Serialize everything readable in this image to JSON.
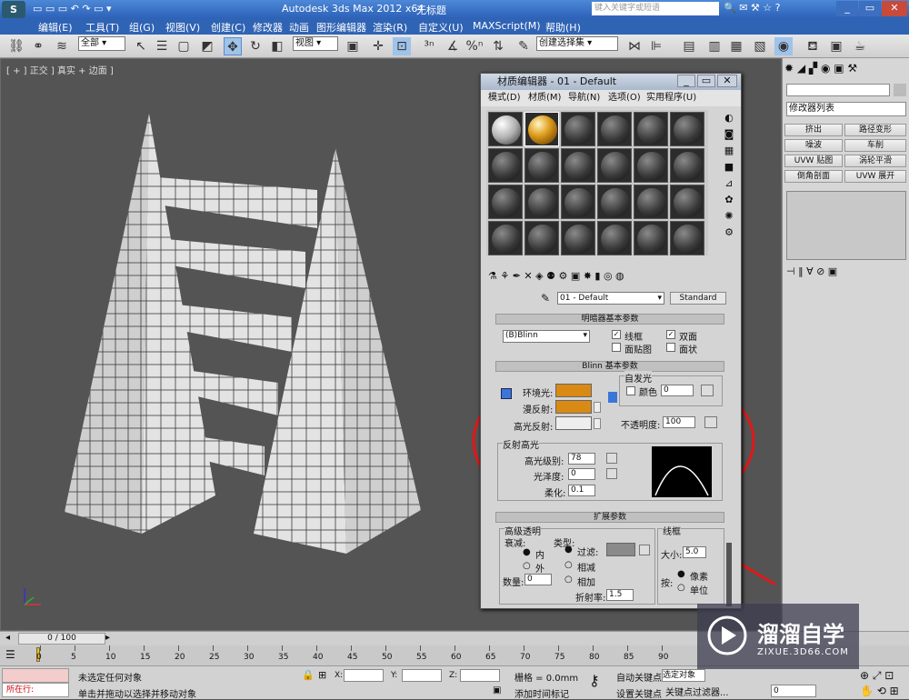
{
  "titlebar": {
    "app_title": "Autodesk 3ds Max  2012 x64",
    "file": "无标题",
    "search_placeholder": "键入关键字或短语"
  },
  "menubar": {
    "items": [
      "编辑(E)",
      "工具(T)",
      "组(G)",
      "视图(V)",
      "创建(C)",
      "修改器",
      "动画",
      "图形编辑器",
      "渲染(R)",
      "自定义(U)",
      "MAXScript(M)",
      "帮助(H)"
    ]
  },
  "toolbar": {
    "filter": "全部",
    "view": "视图",
    "selection_set": "创建选择集"
  },
  "viewport": {
    "label": "[ + ] 正交 ] 真实 + 边面 ]"
  },
  "cmdpanel": {
    "modifier_list": "修改器列表",
    "buttons": [
      "挤出",
      "路径变形",
      "噪波",
      "车削",
      "UVW 贴图",
      "涡轮平滑",
      "倒角剖面",
      "UVW 展开"
    ]
  },
  "mated": {
    "title": "材质编辑器 - 01 - Default",
    "menu": [
      "模式(D)",
      "材质(M)",
      "导航(N)",
      "选项(O)",
      "实用程序(U)"
    ],
    "material_name": "01 - Default",
    "material_type": "Standard",
    "shader_rollout": "明暗器基本参数",
    "shader": "(B)Blinn",
    "opt_wire": "线框",
    "opt_two_sided": "双面",
    "opt_face_map": "面贴图",
    "opt_faceted": "面状",
    "blinn_rollout": "Blinn 基本参数",
    "ambient": "环境光:",
    "diffuse": "漫反射:",
    "specular": "高光反射:",
    "self_illum": "自发光",
    "color": "颜色",
    "self_illum_val": "0",
    "opacity": "不透明度:",
    "opacity_val": "100",
    "spec_group": "反射高光",
    "spec_level": "高光级别:",
    "spec_level_val": "78",
    "gloss": "光泽度:",
    "gloss_val": "0",
    "soften": "柔化:",
    "soften_val": "0.1",
    "ext_rollout": "扩展参数",
    "adv_trans": "高级透明",
    "falloff": "衰减:",
    "type": "类型:",
    "in": "内",
    "out": "外",
    "amt": "数量:",
    "amt_val": "0",
    "filter": "过滤:",
    "subtractive": "相减",
    "additive": "相加",
    "ior": "折射率:",
    "ior_val": "1.5",
    "wire": "线框",
    "size": "大小:",
    "size_val": "5.0",
    "in_label": "按:",
    "pixels": "像素",
    "units": "单位",
    "colors": {
      "ambient": "#d98a14",
      "diffuse": "#d98a14",
      "specular": "#eeeeee",
      "filter": "#8a8a8a"
    }
  },
  "timeline": {
    "frame": "0 / 100",
    "ticks": [
      "0",
      "5",
      "10",
      "15",
      "20",
      "25",
      "30",
      "35",
      "40",
      "45",
      "50",
      "55",
      "60",
      "65",
      "70",
      "75",
      "80",
      "85",
      "90"
    ]
  },
  "status": {
    "location": "所在行:",
    "selection": "未选定任何对象",
    "hint": "单击并拖动以选择并移动对象",
    "x": "X:",
    "y": "Y:",
    "z": "Z:",
    "grid": "栅格 = 0.0mm",
    "add_time_tag": "添加时间标记",
    "auto_key": "自动关键点",
    "set_key": "设置关键点",
    "selected_object": "选定对象",
    "key_filter": "关键点过滤器...",
    "frame_val": "0"
  },
  "watermark": {
    "brand": "溜溜自学",
    "url": "ZIXUE.3D66.COM"
  }
}
